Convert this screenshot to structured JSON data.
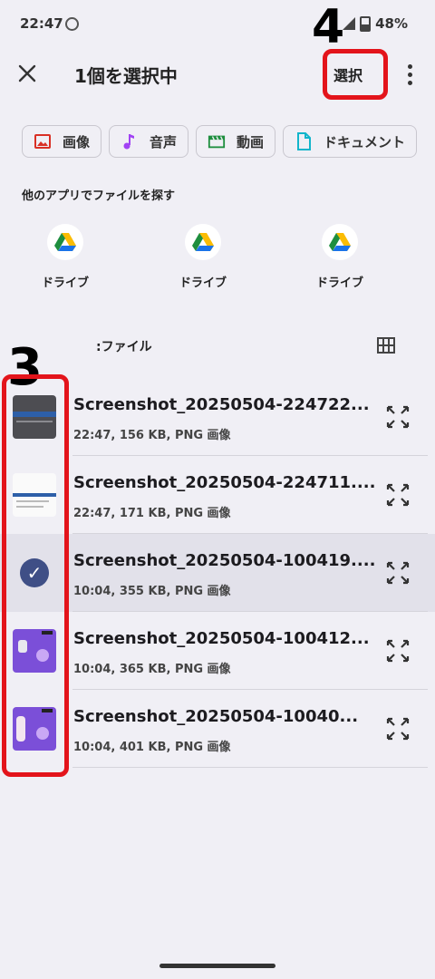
{
  "status": {
    "time": "22:47",
    "battery": "48%"
  },
  "appbar": {
    "title": "1個を選択中",
    "select_label": "選択"
  },
  "chips": [
    {
      "label": "画像",
      "icon": "image-icon",
      "color": "#d93025"
    },
    {
      "label": "音声",
      "icon": "music-icon",
      "color": "#a142f4"
    },
    {
      "label": "動画",
      "icon": "video-icon",
      "color": "#1e8e3e"
    },
    {
      "label": "ドキュメント",
      "icon": "document-icon",
      "color": "#12b5cb"
    }
  ],
  "other_apps": {
    "label": "他のアプリでファイルを探す",
    "apps": [
      {
        "label": "ドライブ"
      },
      {
        "label": "ドライブ"
      },
      {
        "label": "ドライブ"
      }
    ]
  },
  "files_header": ":ファイル",
  "annotations": {
    "step3": "3",
    "step4": "4"
  },
  "files": [
    {
      "name": "Screenshot_20250504-224722...",
      "meta": "22:47, 156 KB, PNG 画像",
      "selected": false
    },
    {
      "name": "Screenshot_20250504-224711....",
      "meta": "22:47, 171 KB, PNG 画像",
      "selected": false
    },
    {
      "name": "Screenshot_20250504-100419....",
      "meta": "10:04, 355 KB, PNG 画像",
      "selected": true
    },
    {
      "name": "Screenshot_20250504-100412...",
      "meta": "10:04, 365 KB, PNG 画像",
      "selected": false
    },
    {
      "name": "Screenshot_20250504-10040...",
      "meta": "10:04, 401 KB, PNG 画像",
      "selected": false
    }
  ],
  "colors": {
    "highlight": "#e3141b",
    "selected_row": "#e2e1ea",
    "check": "#3f4f86"
  }
}
